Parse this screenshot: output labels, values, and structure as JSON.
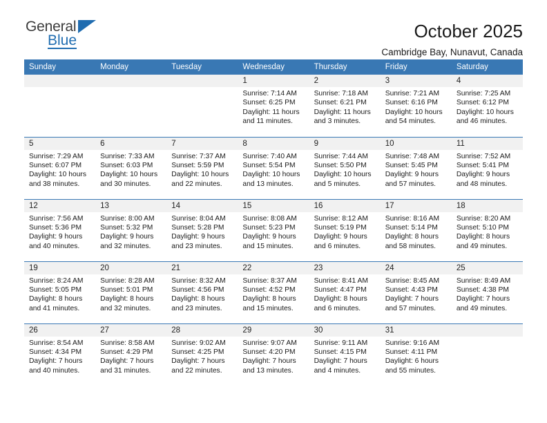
{
  "brand": {
    "line1": "General",
    "line2": "Blue",
    "accent_color": "#1f6cb0",
    "triangle_icon": "triangle-icon"
  },
  "header": {
    "title": "October 2025",
    "subtitle": "Cambridge Bay, Nunavut, Canada"
  },
  "calendar": {
    "header_bg": "#3978b4",
    "daynum_bg": "#f1f1f1",
    "weekday_labels": [
      "Sunday",
      "Monday",
      "Tuesday",
      "Wednesday",
      "Thursday",
      "Friday",
      "Saturday"
    ],
    "weeks": [
      [
        {
          "day": "",
          "empty": true
        },
        {
          "day": "",
          "empty": true
        },
        {
          "day": "",
          "empty": true
        },
        {
          "day": "1",
          "sunrise": "Sunrise: 7:14 AM",
          "sunset": "Sunset: 6:25 PM",
          "daylight": "Daylight: 11 hours and 11 minutes."
        },
        {
          "day": "2",
          "sunrise": "Sunrise: 7:18 AM",
          "sunset": "Sunset: 6:21 PM",
          "daylight": "Daylight: 11 hours and 3 minutes."
        },
        {
          "day": "3",
          "sunrise": "Sunrise: 7:21 AM",
          "sunset": "Sunset: 6:16 PM",
          "daylight": "Daylight: 10 hours and 54 minutes."
        },
        {
          "day": "4",
          "sunrise": "Sunrise: 7:25 AM",
          "sunset": "Sunset: 6:12 PM",
          "daylight": "Daylight: 10 hours and 46 minutes."
        }
      ],
      [
        {
          "day": "5",
          "sunrise": "Sunrise: 7:29 AM",
          "sunset": "Sunset: 6:07 PM",
          "daylight": "Daylight: 10 hours and 38 minutes."
        },
        {
          "day": "6",
          "sunrise": "Sunrise: 7:33 AM",
          "sunset": "Sunset: 6:03 PM",
          "daylight": "Daylight: 10 hours and 30 minutes."
        },
        {
          "day": "7",
          "sunrise": "Sunrise: 7:37 AM",
          "sunset": "Sunset: 5:59 PM",
          "daylight": "Daylight: 10 hours and 22 minutes."
        },
        {
          "day": "8",
          "sunrise": "Sunrise: 7:40 AM",
          "sunset": "Sunset: 5:54 PM",
          "daylight": "Daylight: 10 hours and 13 minutes."
        },
        {
          "day": "9",
          "sunrise": "Sunrise: 7:44 AM",
          "sunset": "Sunset: 5:50 PM",
          "daylight": "Daylight: 10 hours and 5 minutes."
        },
        {
          "day": "10",
          "sunrise": "Sunrise: 7:48 AM",
          "sunset": "Sunset: 5:45 PM",
          "daylight": "Daylight: 9 hours and 57 minutes."
        },
        {
          "day": "11",
          "sunrise": "Sunrise: 7:52 AM",
          "sunset": "Sunset: 5:41 PM",
          "daylight": "Daylight: 9 hours and 48 minutes."
        }
      ],
      [
        {
          "day": "12",
          "sunrise": "Sunrise: 7:56 AM",
          "sunset": "Sunset: 5:36 PM",
          "daylight": "Daylight: 9 hours and 40 minutes."
        },
        {
          "day": "13",
          "sunrise": "Sunrise: 8:00 AM",
          "sunset": "Sunset: 5:32 PM",
          "daylight": "Daylight: 9 hours and 32 minutes."
        },
        {
          "day": "14",
          "sunrise": "Sunrise: 8:04 AM",
          "sunset": "Sunset: 5:28 PM",
          "daylight": "Daylight: 9 hours and 23 minutes."
        },
        {
          "day": "15",
          "sunrise": "Sunrise: 8:08 AM",
          "sunset": "Sunset: 5:23 PM",
          "daylight": "Daylight: 9 hours and 15 minutes."
        },
        {
          "day": "16",
          "sunrise": "Sunrise: 8:12 AM",
          "sunset": "Sunset: 5:19 PM",
          "daylight": "Daylight: 9 hours and 6 minutes."
        },
        {
          "day": "17",
          "sunrise": "Sunrise: 8:16 AM",
          "sunset": "Sunset: 5:14 PM",
          "daylight": "Daylight: 8 hours and 58 minutes."
        },
        {
          "day": "18",
          "sunrise": "Sunrise: 8:20 AM",
          "sunset": "Sunset: 5:10 PM",
          "daylight": "Daylight: 8 hours and 49 minutes."
        }
      ],
      [
        {
          "day": "19",
          "sunrise": "Sunrise: 8:24 AM",
          "sunset": "Sunset: 5:05 PM",
          "daylight": "Daylight: 8 hours and 41 minutes."
        },
        {
          "day": "20",
          "sunrise": "Sunrise: 8:28 AM",
          "sunset": "Sunset: 5:01 PM",
          "daylight": "Daylight: 8 hours and 32 minutes."
        },
        {
          "day": "21",
          "sunrise": "Sunrise: 8:32 AM",
          "sunset": "Sunset: 4:56 PM",
          "daylight": "Daylight: 8 hours and 23 minutes."
        },
        {
          "day": "22",
          "sunrise": "Sunrise: 8:37 AM",
          "sunset": "Sunset: 4:52 PM",
          "daylight": "Daylight: 8 hours and 15 minutes."
        },
        {
          "day": "23",
          "sunrise": "Sunrise: 8:41 AM",
          "sunset": "Sunset: 4:47 PM",
          "daylight": "Daylight: 8 hours and 6 minutes."
        },
        {
          "day": "24",
          "sunrise": "Sunrise: 8:45 AM",
          "sunset": "Sunset: 4:43 PM",
          "daylight": "Daylight: 7 hours and 57 minutes."
        },
        {
          "day": "25",
          "sunrise": "Sunrise: 8:49 AM",
          "sunset": "Sunset: 4:38 PM",
          "daylight": "Daylight: 7 hours and 49 minutes."
        }
      ],
      [
        {
          "day": "26",
          "sunrise": "Sunrise: 8:54 AM",
          "sunset": "Sunset: 4:34 PM",
          "daylight": "Daylight: 7 hours and 40 minutes."
        },
        {
          "day": "27",
          "sunrise": "Sunrise: 8:58 AM",
          "sunset": "Sunset: 4:29 PM",
          "daylight": "Daylight: 7 hours and 31 minutes."
        },
        {
          "day": "28",
          "sunrise": "Sunrise: 9:02 AM",
          "sunset": "Sunset: 4:25 PM",
          "daylight": "Daylight: 7 hours and 22 minutes."
        },
        {
          "day": "29",
          "sunrise": "Sunrise: 9:07 AM",
          "sunset": "Sunset: 4:20 PM",
          "daylight": "Daylight: 7 hours and 13 minutes."
        },
        {
          "day": "30",
          "sunrise": "Sunrise: 9:11 AM",
          "sunset": "Sunset: 4:15 PM",
          "daylight": "Daylight: 7 hours and 4 minutes."
        },
        {
          "day": "31",
          "sunrise": "Sunrise: 9:16 AM",
          "sunset": "Sunset: 4:11 PM",
          "daylight": "Daylight: 6 hours and 55 minutes."
        },
        {
          "day": "",
          "empty": true
        }
      ]
    ]
  }
}
